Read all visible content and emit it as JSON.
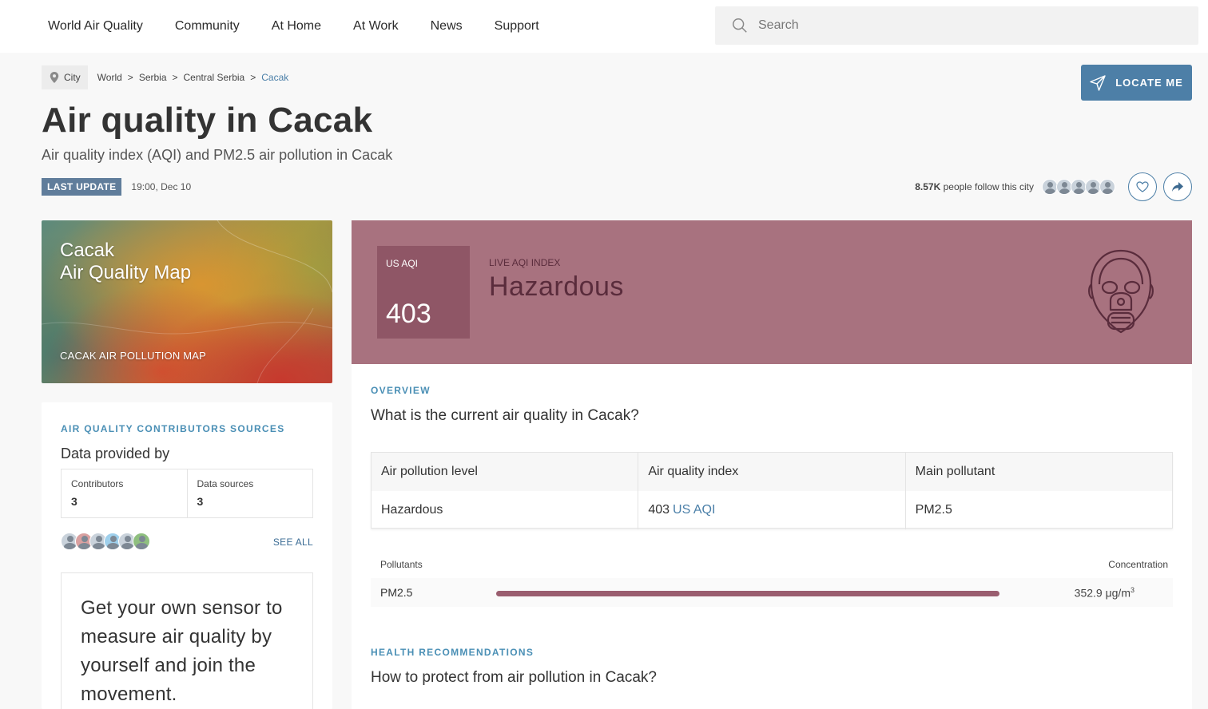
{
  "nav": {
    "items": [
      "World Air Quality",
      "Community",
      "At Home",
      "At Work",
      "News",
      "Support"
    ],
    "search_placeholder": "Search"
  },
  "breadcrumb": {
    "chip": "City",
    "items": [
      "World",
      "Serbia",
      "Central Serbia",
      "Cacak"
    ]
  },
  "locate_label": "LOCATE ME",
  "page": {
    "title": "Air quality in Cacak",
    "subtitle": "Air quality index (AQI) and PM2.5 air pollution in Cacak",
    "last_update_label": "LAST UPDATE",
    "last_update_time": "19:00, Dec 10",
    "followers_count": "8.57K",
    "followers_text": "people follow this city"
  },
  "map_card": {
    "title_line1": "Cacak",
    "title_line2": "Air Quality Map",
    "link_label": "CACAK AIR POLLUTION MAP"
  },
  "contributors": {
    "section_label": "AIR QUALITY CONTRIBUTORS SOURCES",
    "heading": "Data provided by",
    "contributors_label": "Contributors",
    "contributors_value": "3",
    "sources_label": "Data sources",
    "sources_value": "3",
    "see_all": "SEE ALL",
    "sensor_text": "Get your own sensor to measure air quality by yourself and join the movement."
  },
  "aqi": {
    "box_label": "US AQI",
    "value": "403",
    "live_label": "LIVE AQI INDEX",
    "level": "Hazardous",
    "panel_color": "#a8727f",
    "box_color": "#8f5666"
  },
  "overview": {
    "section_label": "OVERVIEW",
    "question": "What is the current air quality in Cacak?",
    "table_headers": [
      "Air pollution level",
      "Air quality index",
      "Main pollutant"
    ],
    "table_row": {
      "level": "Hazardous",
      "index_value": "403",
      "index_unit": "US AQI",
      "pollutant": "PM2.5"
    },
    "pollutants_label": "Pollutants",
    "concentration_label": "Concentration",
    "pollutant_rows": [
      {
        "name": "PM2.5",
        "value": "352.9 μg/m",
        "unit_sup": "3"
      }
    ]
  },
  "health": {
    "section_label": "HEALTH RECOMMENDATIONS",
    "question": "How to protect from air pollution in Cacak?"
  }
}
